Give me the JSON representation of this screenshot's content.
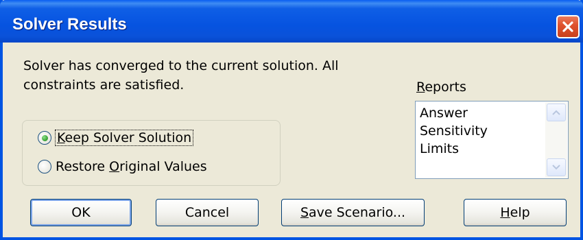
{
  "window": {
    "title": "Solver Results",
    "close_icon": "close-icon"
  },
  "message": {
    "line1": "Solver has converged to the current solution.  All",
    "line2": "constraints are satisfied."
  },
  "options": {
    "keep": {
      "pre": "",
      "accel": "K",
      "post": "eep Solver Solution",
      "selected": true
    },
    "restore": {
      "pre": "Restore ",
      "accel": "O",
      "post": "riginal Values",
      "selected": false
    }
  },
  "reports": {
    "label_accel": "R",
    "label_rest": "eports",
    "items": [
      "Answer",
      "Sensitivity",
      "Limits"
    ]
  },
  "buttons": {
    "ok": "OK",
    "cancel": "Cancel",
    "save_accel": "S",
    "save_rest": "ave Scenario...",
    "help_accel": "H",
    "help_rest": "elp"
  },
  "colors": {
    "titlebar": "#0054e3",
    "dialog_bg": "#ece9d8",
    "close_button": "#e0532f"
  }
}
